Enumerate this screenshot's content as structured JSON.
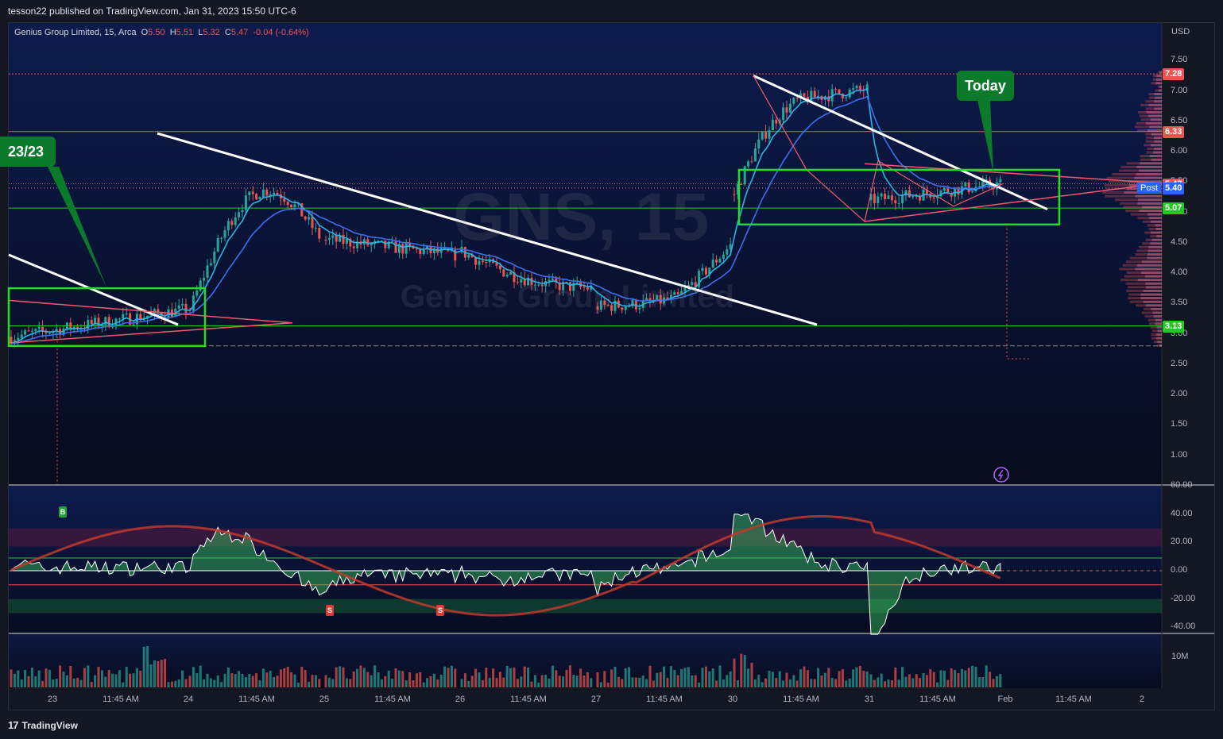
{
  "header": {
    "publisher_text": "tesson22 published on TradingView.com, Jan 31, 2023 15:50 UTC-6"
  },
  "legend": {
    "symbol": "Genius Group Limited, 15, Arca",
    "open_label": "O",
    "open": "5.50",
    "high_label": "H",
    "high": "5.51",
    "low_label": "L",
    "low": "5.32",
    "close_label": "C",
    "close": "5.47",
    "change": "-0.04 (-0.64%)"
  },
  "watermark": {
    "ticker": "GNS, 15",
    "name": "Genius Group Limited"
  },
  "annotations": {
    "today": "Today",
    "date_box": "23/23"
  },
  "price_axis": {
    "currency": "USD",
    "ticks": [
      "7.50",
      "7.00",
      "6.50",
      "6.00",
      "5.50",
      "5.00",
      "4.50",
      "4.00",
      "3.50",
      "3.00",
      "2.50",
      "2.00",
      "1.50",
      "1.00"
    ],
    "tags": [
      {
        "value": "7.28",
        "color": "#ef5350"
      },
      {
        "value": "6.33",
        "color": "#ef5350"
      },
      {
        "value": "5.47",
        "color": "#ef5350"
      },
      {
        "value": "5.40",
        "color": "#2962ff"
      },
      {
        "value": "5.07",
        "color": "#22c922"
      },
      {
        "value": "3.13",
        "color": "#22c922"
      }
    ],
    "post_label": "Post"
  },
  "osc_axis": {
    "ticks": [
      "60.00",
      "40.00",
      "20.00",
      "0.00",
      "-20.00",
      "-40.00"
    ]
  },
  "volume_axis": {
    "ticks": [
      "10M"
    ]
  },
  "time_axis": {
    "ticks": [
      "23",
      "11:45 AM",
      "24",
      "11:45 AM",
      "25",
      "11:45 AM",
      "26",
      "11:45 AM",
      "27",
      "11:45 AM",
      "30",
      "11:45 AM",
      "31",
      "11:45 AM",
      "Feb",
      "11:45 AM",
      "2"
    ]
  },
  "signals": [
    {
      "label": "B",
      "color": "#22a33a"
    },
    {
      "label": "S",
      "color": "#e53935"
    },
    {
      "label": "S",
      "color": "#e53935"
    }
  ],
  "footer": {
    "brand": "TradingView"
  },
  "colors": {
    "up": "#26a69a",
    "down": "#ef5350",
    "ma_fast": "#2ab4e8",
    "ma_slow": "#3b6ff0",
    "box": "#22dd22",
    "trend": "#ffffff",
    "wedge": "#f25a6a"
  },
  "chart_data": {
    "type": "candlestick",
    "symbol": "GNS",
    "interval": "15",
    "ylim": [
      0.6,
      7.9
    ],
    "key_levels": [
      7.28,
      6.33,
      5.47,
      5.4,
      5.07,
      3.13
    ],
    "segments": [
      {
        "day": "23",
        "start": 2.95,
        "end": 3.4
      },
      {
        "day": "24",
        "start": 3.4,
        "end": 4.6
      },
      {
        "day": "25",
        "start": 4.55,
        "end": 4.3
      },
      {
        "day": "26",
        "start": 4.35,
        "end": 3.75
      },
      {
        "day": "27",
        "start": 3.45,
        "end": 3.85
      },
      {
        "day": "30",
        "start": 5.3,
        "end": 6.4
      },
      {
        "day": "31",
        "start": 5.2,
        "end": 5.47
      }
    ],
    "oscillator": {
      "ylim": [
        -50,
        60
      ],
      "levels": [
        40,
        20,
        0,
        -20,
        -40
      ]
    }
  }
}
